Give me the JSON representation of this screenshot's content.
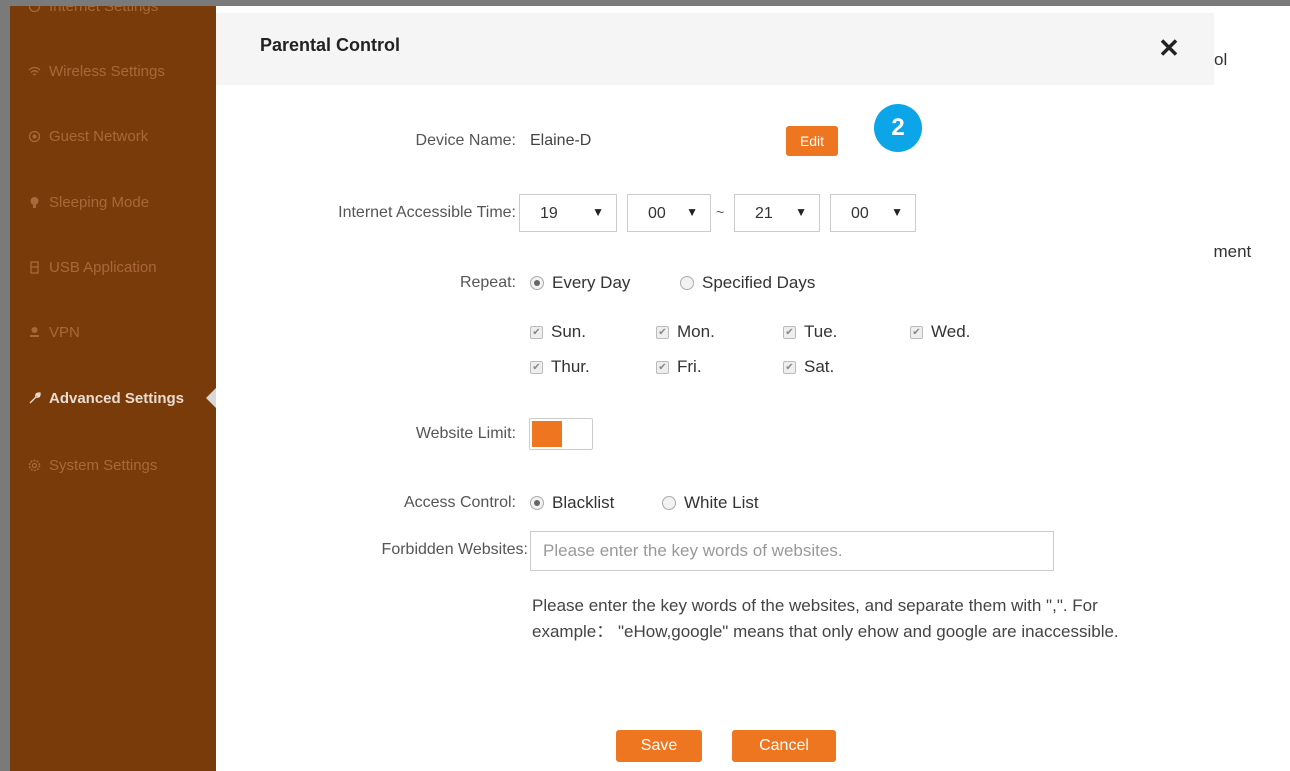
{
  "sidebar": {
    "items": [
      {
        "label": "Internet Settings",
        "icon": "globe-icon"
      },
      {
        "label": "Wireless Settings",
        "icon": "wifi-icon"
      },
      {
        "label": "Guest Network",
        "icon": "guest-icon"
      },
      {
        "label": "Sleeping Mode",
        "icon": "bulb-icon"
      },
      {
        "label": "USB Application",
        "icon": "usb-icon"
      },
      {
        "label": "VPN",
        "icon": "vpn-icon"
      },
      {
        "label": "Advanced Settings",
        "icon": "wrench-icon",
        "active": true
      },
      {
        "label": "System Settings",
        "icon": "gear-icon"
      }
    ]
  },
  "background": {
    "fragment_right_1": "ol",
    "fragment_right_2": "ement"
  },
  "modal": {
    "title": "Parental Control",
    "close_glyph": "✕",
    "step_badge": "2",
    "device_name_label": "Device Name:",
    "device_name_value": "Elaine-D",
    "edit_label": "Edit",
    "time_label": "Internet Accessible Time:",
    "time": {
      "start_hour": "19",
      "start_minute": "00",
      "separator": "~",
      "end_hour": "21",
      "end_minute": "00"
    },
    "repeat_label": "Repeat:",
    "repeat_options": [
      {
        "label": "Every Day",
        "selected": true
      },
      {
        "label": "Specified Days",
        "selected": false
      }
    ],
    "days": [
      {
        "label": "Sun.",
        "checked": true
      },
      {
        "label": "Mon.",
        "checked": true
      },
      {
        "label": "Tue.",
        "checked": true
      },
      {
        "label": "Wed.",
        "checked": true
      },
      {
        "label": "Thur.",
        "checked": true
      },
      {
        "label": "Fri.",
        "checked": true
      },
      {
        "label": "Sat.",
        "checked": true
      }
    ],
    "website_limit_label": "Website Limit:",
    "website_limit_on": true,
    "access_control_label": "Access Control:",
    "access_options": [
      {
        "label": "Blacklist",
        "selected": true
      },
      {
        "label": "White List",
        "selected": false
      }
    ],
    "forbidden_label": "Forbidden Websites:",
    "forbidden_placeholder": "Please enter the key words of websites.",
    "forbidden_value": "",
    "help_text": "Please enter the key words of the websites, and separate them with \",\". For example： \"eHow,google\" means that only ehow and google are inaccessible.",
    "save_label": "Save",
    "cancel_label": "Cancel"
  },
  "colors": {
    "accent": "#ee7621",
    "sidebar_bg": "#7a3b0a",
    "badge": "#0ba5e8"
  }
}
